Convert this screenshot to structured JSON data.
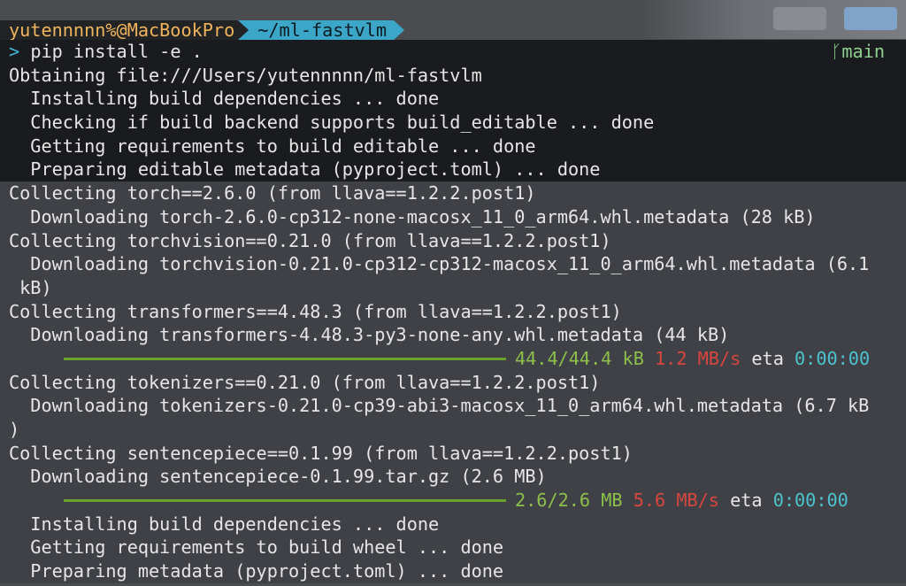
{
  "prompt": {
    "user": "yutennnnn%@MacBookPro",
    "path": "~/ml-fastvlm",
    "caret": ">",
    "command": "pip install -e .",
    "branch_icon": "git-branch-icon",
    "branch_glyph": "ᚴ",
    "branch": "main"
  },
  "lines": [
    {
      "text": "Obtaining file:///Users/yutennnnn/ml-fastvlm"
    },
    {
      "text": "  Installing build dependencies ... done"
    },
    {
      "text": "  Checking if build backend supports build_editable ... done"
    },
    {
      "text": "  Getting requirements to build editable ... done"
    },
    {
      "text": "  Preparing editable metadata (pyproject.toml) ... done"
    },
    {
      "text": "Collecting torch==2.6.0 (from llava==1.2.2.post1)"
    },
    {
      "text": "  Downloading torch-2.6.0-cp312-none-macosx_11_0_arm64.whl.metadata (28 kB)"
    },
    {
      "text": "Collecting torchvision==0.21.0 (from llava==1.2.2.post1)"
    },
    {
      "text": "  Downloading torchvision-0.21.0-cp312-cp312-macosx_11_0_arm64.whl.metadata (6.1"
    },
    {
      "text": " kB)"
    },
    {
      "text": "Collecting transformers==4.48.3 (from llava==1.2.2.post1)"
    },
    {
      "text": "  Downloading transformers-4.48.3-py3-none-any.whl.metadata (44 kB)"
    }
  ],
  "progress1": {
    "size": "44.4/44.4 kB",
    "speed": "1.2 MB/s",
    "eta_label": "eta",
    "eta": "0:00:00",
    "fraction": 1.0
  },
  "lines2": [
    {
      "text": "Collecting tokenizers==0.21.0 (from llava==1.2.2.post1)"
    },
    {
      "text": "  Downloading tokenizers-0.21.0-cp39-abi3-macosx_11_0_arm64.whl.metadata (6.7 kB"
    },
    {
      "text": ")"
    },
    {
      "text": "Collecting sentencepiece==0.1.99 (from llava==1.2.2.post1)"
    },
    {
      "text": "  Downloading sentencepiece-0.1.99.tar.gz (2.6 MB)"
    }
  ],
  "progress2": {
    "size": "2.6/2.6 MB",
    "speed": "5.6 MB/s",
    "eta_label": "eta",
    "eta": "0:00:00",
    "fraction": 1.0
  },
  "lines3": [
    {
      "text": "  Installing build dependencies ... done"
    },
    {
      "text": "  Getting requirements to build wheel ... done"
    },
    {
      "text": "  Preparing metadata (pyproject.toml) ... done"
    }
  ],
  "colors": {
    "progress_bar": "#6aa230",
    "speed": "#d9463f",
    "eta": "#4cc4cf",
    "path_bg": "#3ba6c8",
    "user_fg": "#f0b45c"
  }
}
